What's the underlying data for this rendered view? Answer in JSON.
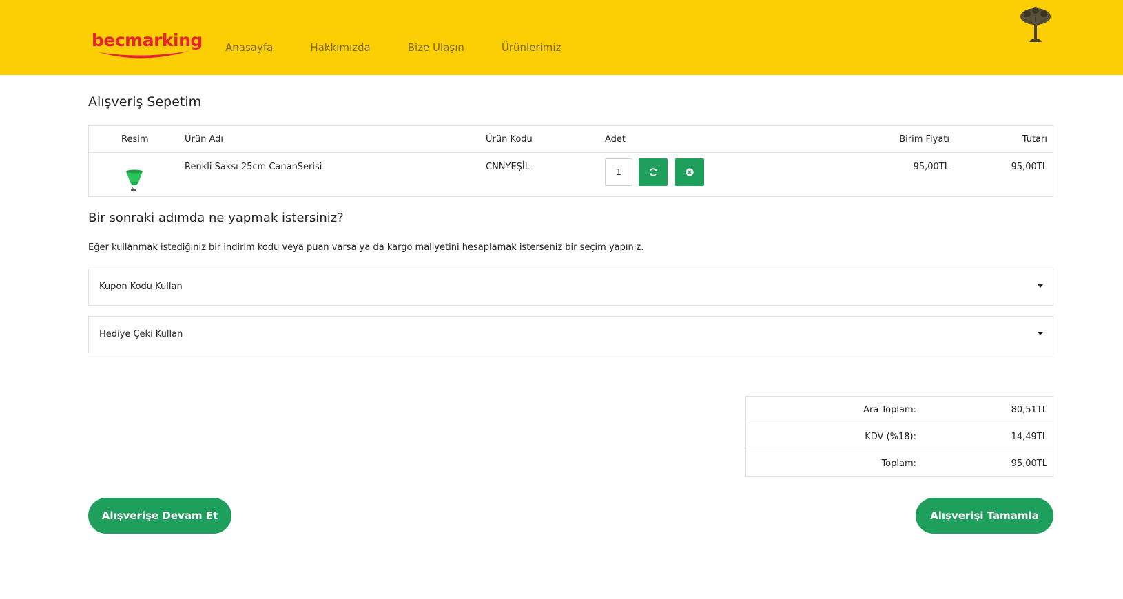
{
  "header": {
    "logo_text": "becmarking",
    "nav": [
      "Anasayfa",
      "Hakkımızda",
      "Bize Ulaşın",
      "Ürünlerimiz"
    ]
  },
  "cart": {
    "title": "Alışveriş Sepetim",
    "columns": {
      "image": "Resim",
      "name": "Ürün Adı",
      "code": "Ürün Kodu",
      "quantity": "Adet",
      "unit_price": "Birim Fiyatı",
      "total": "Tutarı"
    },
    "items": [
      {
        "name": "Renkli Saksı 25cm CananSerisi",
        "code": "CNNYEŞİL",
        "quantity": "1",
        "unit_price": "95,00TL",
        "total": "95,00TL"
      }
    ]
  },
  "next_step": {
    "title": "Bir sonraki adımda ne yapmak istersiniz?",
    "description": "Eğer kullanmak istediğiniz bir indirim kodu veya puan varsa ya da kargo maliyetini hesaplamak isterseniz bir seçim yapınız.",
    "options": [
      "Kupon Kodu Kullan",
      "Hediye Çeki Kullan"
    ]
  },
  "totals": [
    {
      "label": "Ara Toplam:",
      "value": "80,51TL"
    },
    {
      "label": "KDV (%18):",
      "value": "14,49TL"
    },
    {
      "label": "Toplam:",
      "value": "95,00TL"
    }
  ],
  "actions": {
    "continue_label": "Alışverişe Devam Et",
    "checkout_label": "Alışverişi Tamamla"
  },
  "colors": {
    "header_bg": "#FCCF05",
    "brand_red": "#E4242E",
    "accent_green": "#1EA05C"
  }
}
